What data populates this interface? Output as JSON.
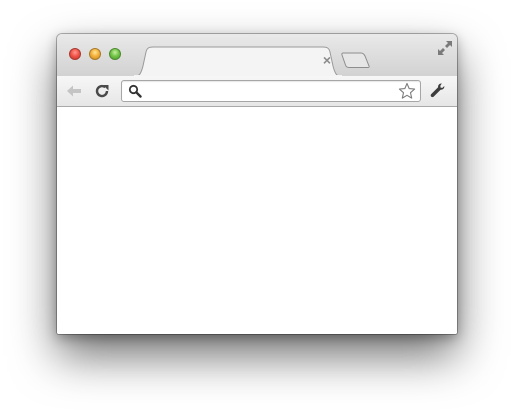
{
  "window": {
    "title_tab": {
      "label": "",
      "close_glyph": "×"
    }
  },
  "traffic_lights": {
    "close_color": "#f1564b",
    "minimize_color": "#f4b23c",
    "zoom_color": "#74c649"
  },
  "toolbar": {
    "back_icon": "back-arrow-icon",
    "reload_icon": "reload-icon",
    "settings_icon": "wrench-icon"
  },
  "omnibox": {
    "value": "",
    "placeholder": "",
    "search_icon": "magnifier-icon",
    "bookmark_icon": "star-icon"
  },
  "page": {
    "content": ""
  }
}
